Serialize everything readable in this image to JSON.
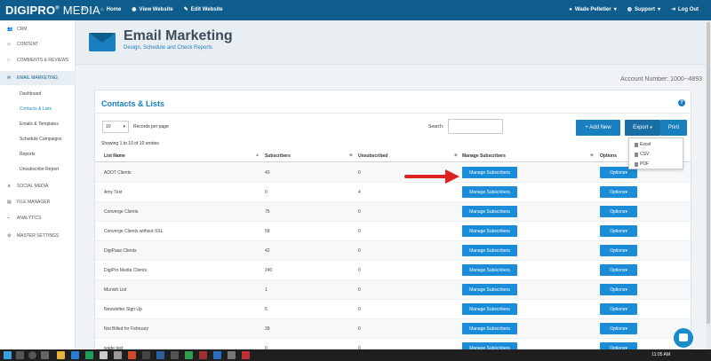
{
  "topbar": {
    "logo_bold": "DIGIPRO",
    "logo_light": "MEDIA",
    "collapse_icon": "«",
    "nav": [
      {
        "label": "Home",
        "icon": "home-icon"
      },
      {
        "label": "View Website",
        "icon": "eye-icon"
      },
      {
        "label": "Edit Website",
        "icon": "edit-icon"
      }
    ],
    "user": "Wade Pelletier",
    "support": "Support",
    "logout": "Log Out"
  },
  "sidebar": {
    "items": [
      {
        "label": "CRM",
        "icon": "users-icon"
      },
      {
        "label": "CONTENT",
        "icon": "diamond-icon"
      },
      {
        "label": "COMMENTS & REVIEWS",
        "icon": "comment-icon"
      },
      {
        "label": "EMAIL MARKETING",
        "icon": "envelope-icon"
      },
      {
        "label": "SOCIAL MEDIA",
        "icon": "share-icon"
      },
      {
        "label": "FILE MANAGER",
        "icon": "folder-icon"
      },
      {
        "label": "ANALYTICS",
        "icon": "chart-icon"
      },
      {
        "label": "MASTER SETTINGS",
        "icon": "gear-icon"
      }
    ],
    "sub_items": [
      "Dashboard",
      "Contacts & Lists",
      "Emails & Templates",
      "Schedule Campaigns",
      "Reports",
      "Unsubscribe Report"
    ]
  },
  "header": {
    "title": "Email Marketing",
    "subtitle": "Design, Schedule and Check Reports"
  },
  "account_number": "Account Number: 1000--4893",
  "panel": {
    "title": "Contacts & Lists",
    "records_value": "10",
    "records_label": "Records per page",
    "search_label": "Search:",
    "search_value": "",
    "add_new": "+ Add New",
    "export": "Export",
    "print": "Print",
    "export_options": [
      "Excel",
      "CSV",
      "PDF"
    ],
    "showing": "Showing 1 to 10 of 10 entries",
    "columns": [
      "List Name",
      "Subscribers",
      "Unsubscribed",
      "Manage Subscribers",
      "Options"
    ],
    "manage_label": "Manage Subscribers",
    "options_label": "Options",
    "rows": [
      {
        "name": "ADOT Clients",
        "subscribers": "40",
        "unsubscribed": "0"
      },
      {
        "name": "Amy Test",
        "subscribers": "0",
        "unsubscribed": "4"
      },
      {
        "name": "Converge Clients",
        "subscribers": "75",
        "unsubscribed": "0"
      },
      {
        "name": "Converge Clients without SSL",
        "subscribers": "58",
        "unsubscribed": "0"
      },
      {
        "name": "DigiPaas Clients",
        "subscribers": "42",
        "unsubscribed": "0"
      },
      {
        "name": "DigiPro Media Clients",
        "subscribers": "240",
        "unsubscribed": "0"
      },
      {
        "name": "Munish List",
        "subscribers": "1",
        "unsubscribed": "0"
      },
      {
        "name": "Newsletter Sign Up",
        "subscribers": "5",
        "unsubscribed": "0"
      },
      {
        "name": "Not Billed for February",
        "subscribers": "39",
        "unsubscribed": "0"
      },
      {
        "name": "wade test",
        "subscribers": "0",
        "unsubscribed": "0"
      }
    ]
  },
  "taskbar": {
    "time": "11:05 AM"
  },
  "colors": {
    "topbar": "#0f5d8c",
    "accent": "#1a8cd8",
    "annotation": "#e02020"
  }
}
